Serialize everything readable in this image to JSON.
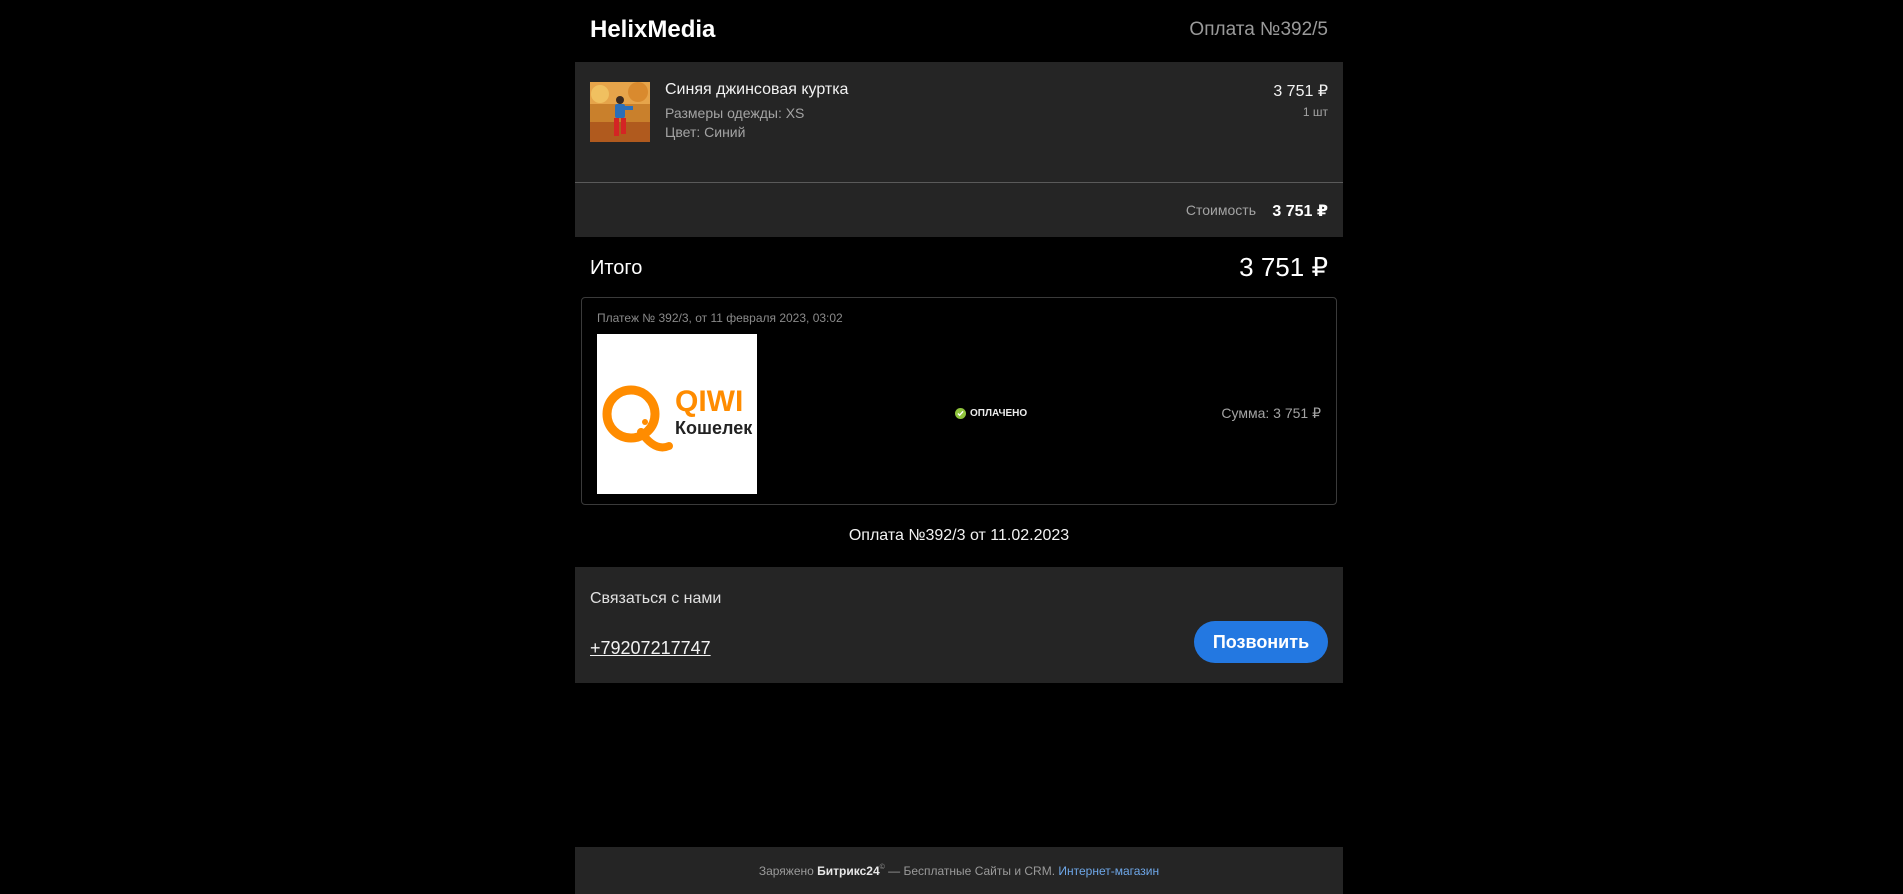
{
  "header": {
    "brand": "HelixMedia",
    "order_title": "Оплата №392/5"
  },
  "product": {
    "name": "Синяя джинсовая куртка",
    "size": "Размеры одежды: XS",
    "color": "Цвет: Синий",
    "price": "3 751 ₽",
    "quantity": "1 шт",
    "thumbnail_icon": "product-photo-icon"
  },
  "cost": {
    "label": "Стоимость",
    "value": "3 751 ₽"
  },
  "total": {
    "label": "Итого",
    "value": "3 751 ₽"
  },
  "payment": {
    "meta": "Платеж № 392/3, от 11 февраля 2023, 03:02",
    "logo_text_top": "QIWI",
    "logo_text_bottom": "Кошелек",
    "status": "ОПЛАЧЕНО",
    "sum": "Сумма: 3 751 ₽",
    "status_color": "#8fc33c",
    "logo_color": "#ff8c00"
  },
  "invoice": {
    "label": "Оплата №392/3 от 11.02.2023"
  },
  "contact": {
    "title": "Связаться с нами",
    "phone": "+79207217747",
    "call_button": "Позвонить",
    "button_color": "#2378e1"
  },
  "footer": {
    "prefix": "Заряжено",
    "brand": "Битрикс24",
    "mark": "©",
    "middle": "— Бесплатные Сайты и CRM.",
    "link": "Интернет-магазин"
  }
}
